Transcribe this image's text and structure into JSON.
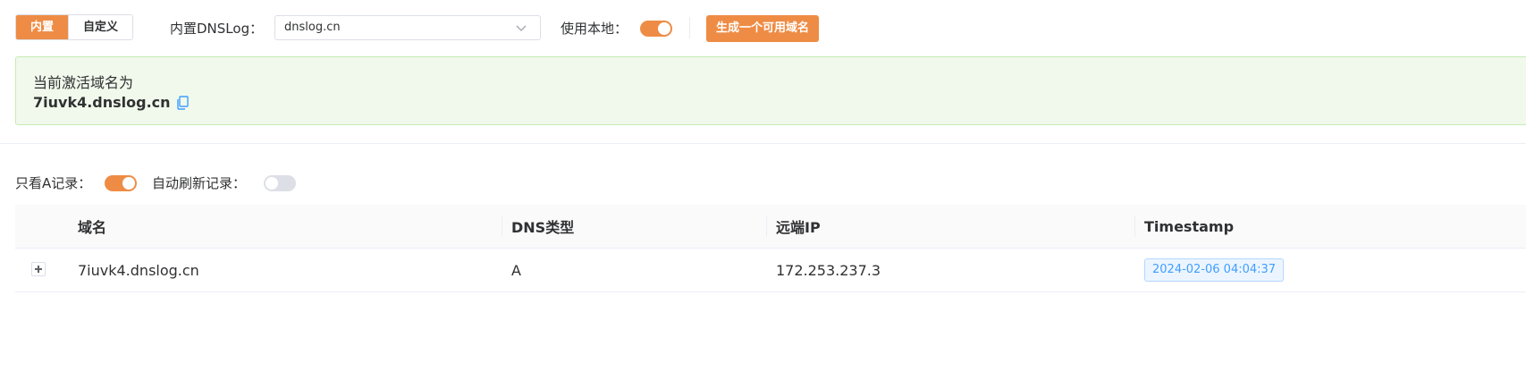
{
  "toolbar": {
    "tabs": [
      {
        "label": "内置",
        "active": true
      },
      {
        "label": "自定义",
        "active": false
      }
    ],
    "dnslog_label": "内置DNSLog：",
    "dnslog_select_value": "dnslog.cn",
    "use_local_label": "使用本地：",
    "use_local_enabled": true,
    "generate_button": "生成一个可用域名"
  },
  "alert": {
    "title": "当前激活域名为",
    "domain": "7iuvk4.dnslog.cn"
  },
  "filters": {
    "only_a_label": "只看A记录：",
    "only_a_enabled": true,
    "auto_refresh_label": "自动刷新记录：",
    "auto_refresh_enabled": false
  },
  "table": {
    "headers": [
      "域名",
      "DNS类型",
      "远端IP",
      "Timestamp"
    ],
    "rows": [
      {
        "domain": "7iuvk4.dnslog.cn",
        "type": "A",
        "ip": "172.253.237.3",
        "timestamp": "2024-02-06 04:04:37"
      }
    ]
  },
  "colors": {
    "accent": "#ee8c45",
    "success_bg": "#f0f9eb",
    "tag_blue": "#409eff"
  }
}
